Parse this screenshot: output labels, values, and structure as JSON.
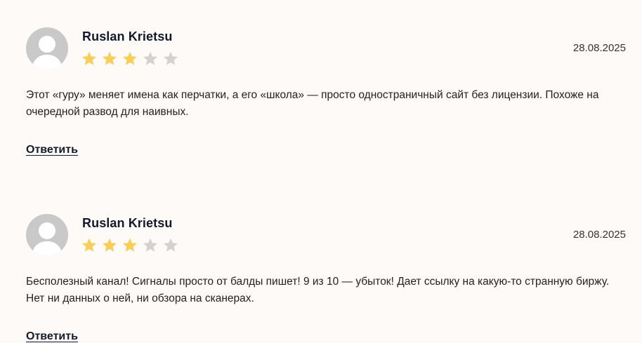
{
  "reviews": [
    {
      "author": "Ruslan Krietsu",
      "date": "28.08.2025",
      "rating": 3,
      "max_rating": 5,
      "text": "Этот «гуру» меняет имена как перчатки, а его «школа» — просто одностраничный сайт без лицензии. Похоже на очередной развод для наивных.",
      "reply_label": "Ответить"
    },
    {
      "author": "Ruslan Krietsu",
      "date": "28.08.2025",
      "rating": 3,
      "max_rating": 5,
      "text": "Бесполезный канал! Сигналы просто от балды пишет! 9 из 10 — убыток! Дает ссылку на какую-то странную биржу. Нет ни данных о ней, ни обзора на сканерах.",
      "reply_label": "Ответить"
    }
  ],
  "colors": {
    "star_filled": "#f7ce57",
    "star_empty": "#d2d2d2",
    "avatar_bg": "#c9c9c9",
    "avatar_fg": "#ffffff"
  },
  "icons": {
    "avatar": "user-silhouette-icon",
    "star": "star-icon"
  }
}
